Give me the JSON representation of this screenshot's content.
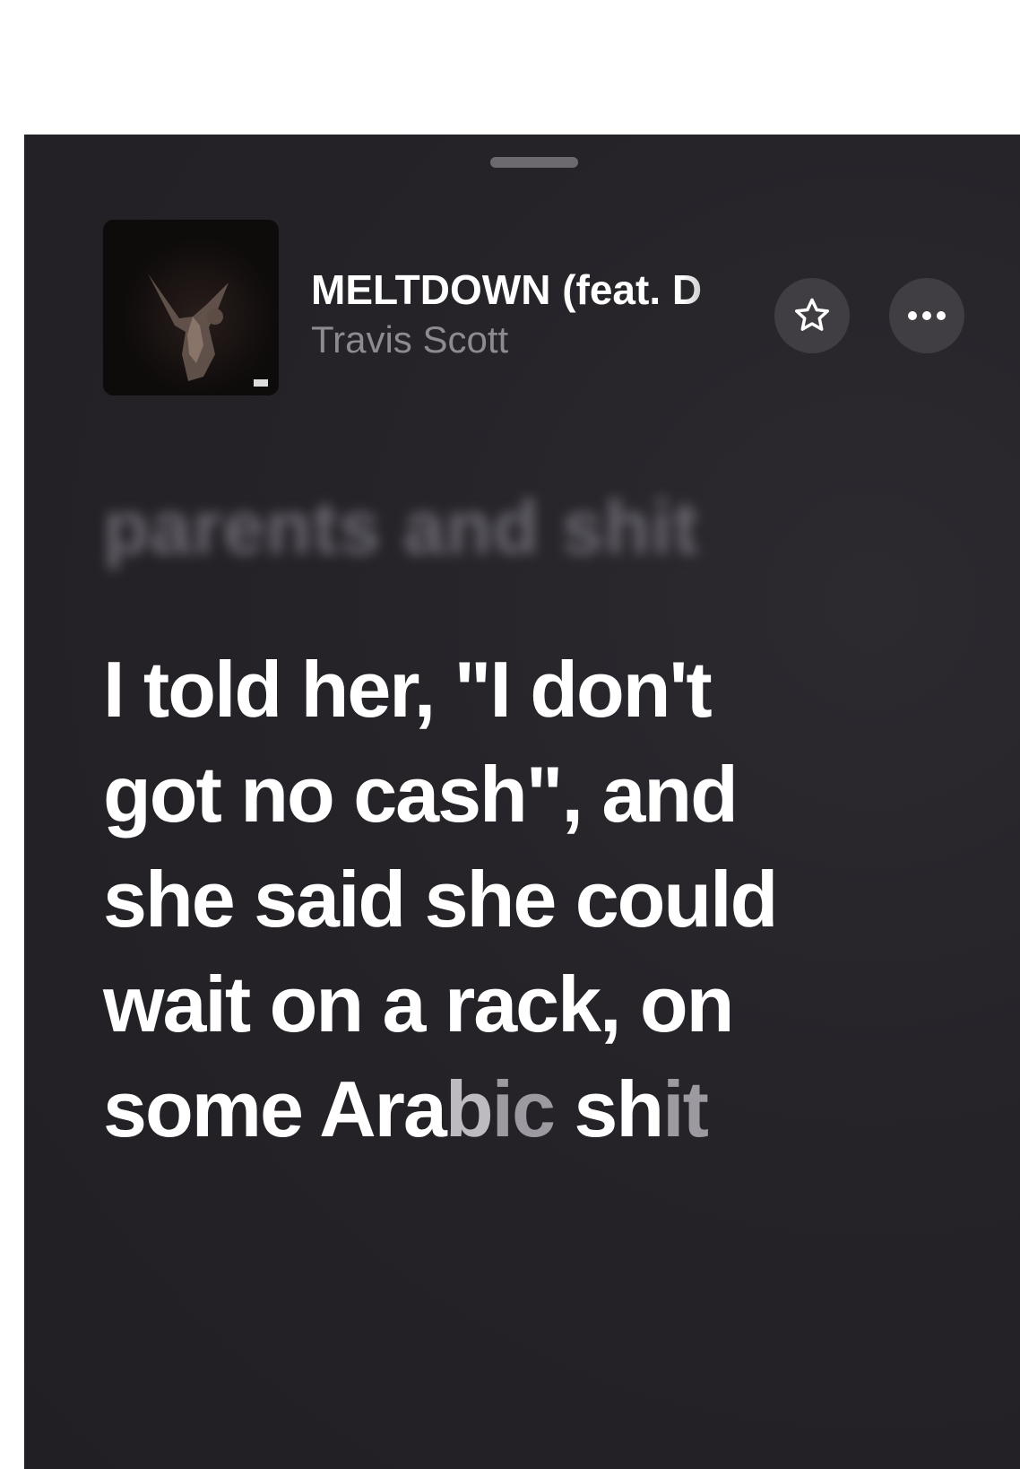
{
  "header": {
    "song_title": "MELTDOWN (feat. D",
    "artist": "Travis Scott",
    "artwork_icon": "album-artwork-image",
    "favorite_icon": "star-icon",
    "more_icon": "ellipsis-icon"
  },
  "lyrics": {
    "previous_line": "parents and shit",
    "current_line_main": "I told her, \"I don't got no cash\", and she said she could wait on a rack, on some Ara",
    "current_line_fade_a": "b",
    "current_line_fade_b": "ic",
    "current_line_fade_c": "sh",
    "current_line_fade_d": "it"
  },
  "colors": {
    "background": "#252328",
    "lyric_active": "#ffffff",
    "artist_text": "#8d8a90",
    "button_bg": "#403e43"
  }
}
